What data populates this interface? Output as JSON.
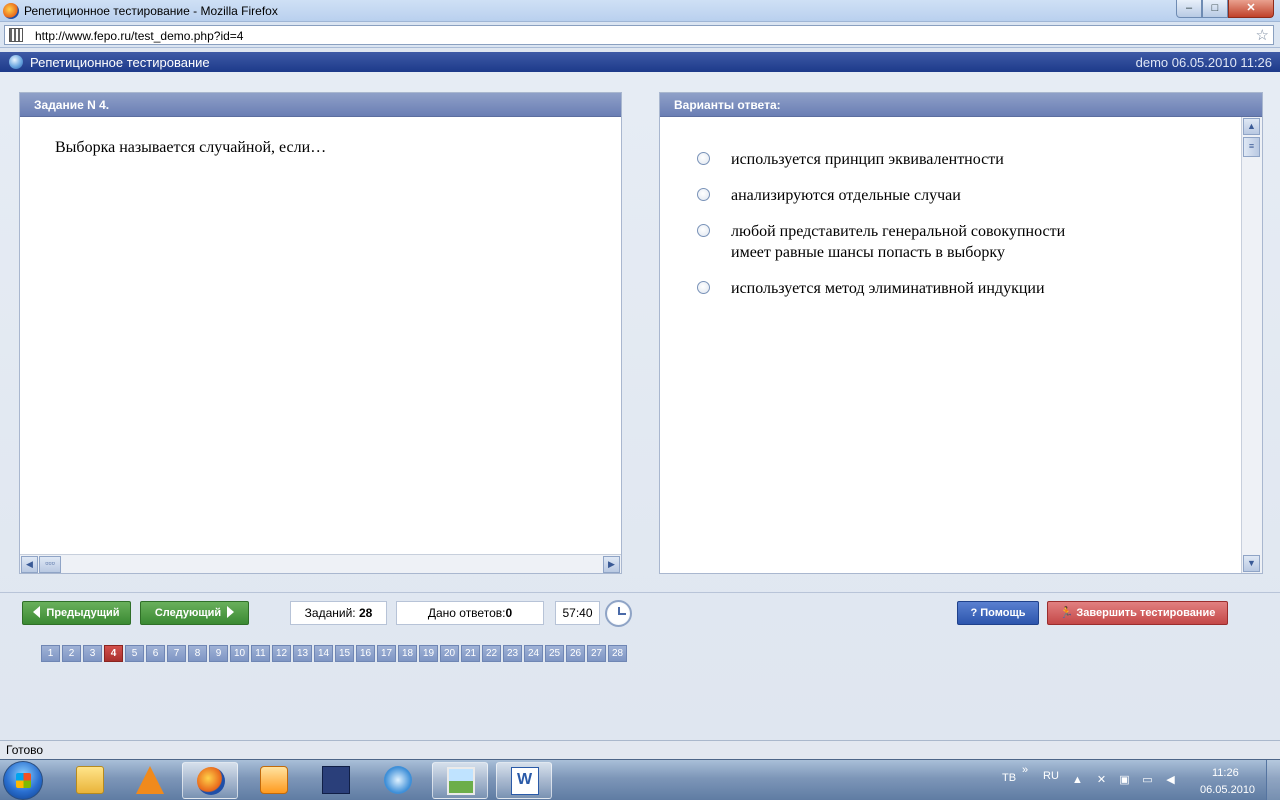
{
  "window": {
    "title": "Репетиционное тестирование - Mozilla Firefox",
    "min_label": "–",
    "max_label": "□",
    "close_label": "✕"
  },
  "browser": {
    "url": "http://www.fepo.ru/test_demo.php?id=4",
    "status": "Готово"
  },
  "app": {
    "title": "Репетиционное тестирование",
    "user_info": "demo 06.05.2010 11:26"
  },
  "task": {
    "header": "Задание N 4.",
    "question": "Выборка называется случайной, если…"
  },
  "answers": {
    "header": "Варианты ответа:",
    "options": [
      {
        "text": "используется принцип эквивалентности"
      },
      {
        "text": "анализируются отдельные случаи"
      },
      {
        "line1": "любой представитель генеральной совокупности",
        "line2": "имеет равные шансы попасть в выборку"
      },
      {
        "text": "используется метод элиминативной индукции"
      }
    ]
  },
  "nav": {
    "prev_label": "Предыдущий",
    "next_label": "Следующий",
    "tasks_label": "Заданий: ",
    "tasks_count": "28",
    "answers_label": "Дано ответов:",
    "answers_count": "0",
    "timer": "57:40",
    "help_label": "Помощь",
    "help_icon": "?",
    "finish_label": "Завершить тестирование"
  },
  "pages": {
    "current": 4,
    "items": [
      "1",
      "2",
      "3",
      "4",
      "5",
      "6",
      "7",
      "8",
      "9",
      "10",
      "11",
      "12",
      "13",
      "14",
      "15",
      "16",
      "17",
      "18",
      "19",
      "20",
      "21",
      "22",
      "23",
      "24",
      "25",
      "26",
      "27",
      "28"
    ]
  },
  "taskbar": {
    "lang_tv": "ТВ",
    "lang_ru": "RU",
    "time": "11:26",
    "date": "06.05.2010",
    "apps": [
      "explorer",
      "vlc",
      "firefox",
      "media-player",
      "save",
      "itunes",
      "picture-viewer",
      "word"
    ]
  },
  "colors": {
    "header_blue": "#1d3a8a",
    "panel_head": "#6a7eb4",
    "nav_green": "#3b8a33",
    "help_blue": "#2c55ad",
    "finish_red": "#c44848",
    "page_current": "#a9302c"
  }
}
